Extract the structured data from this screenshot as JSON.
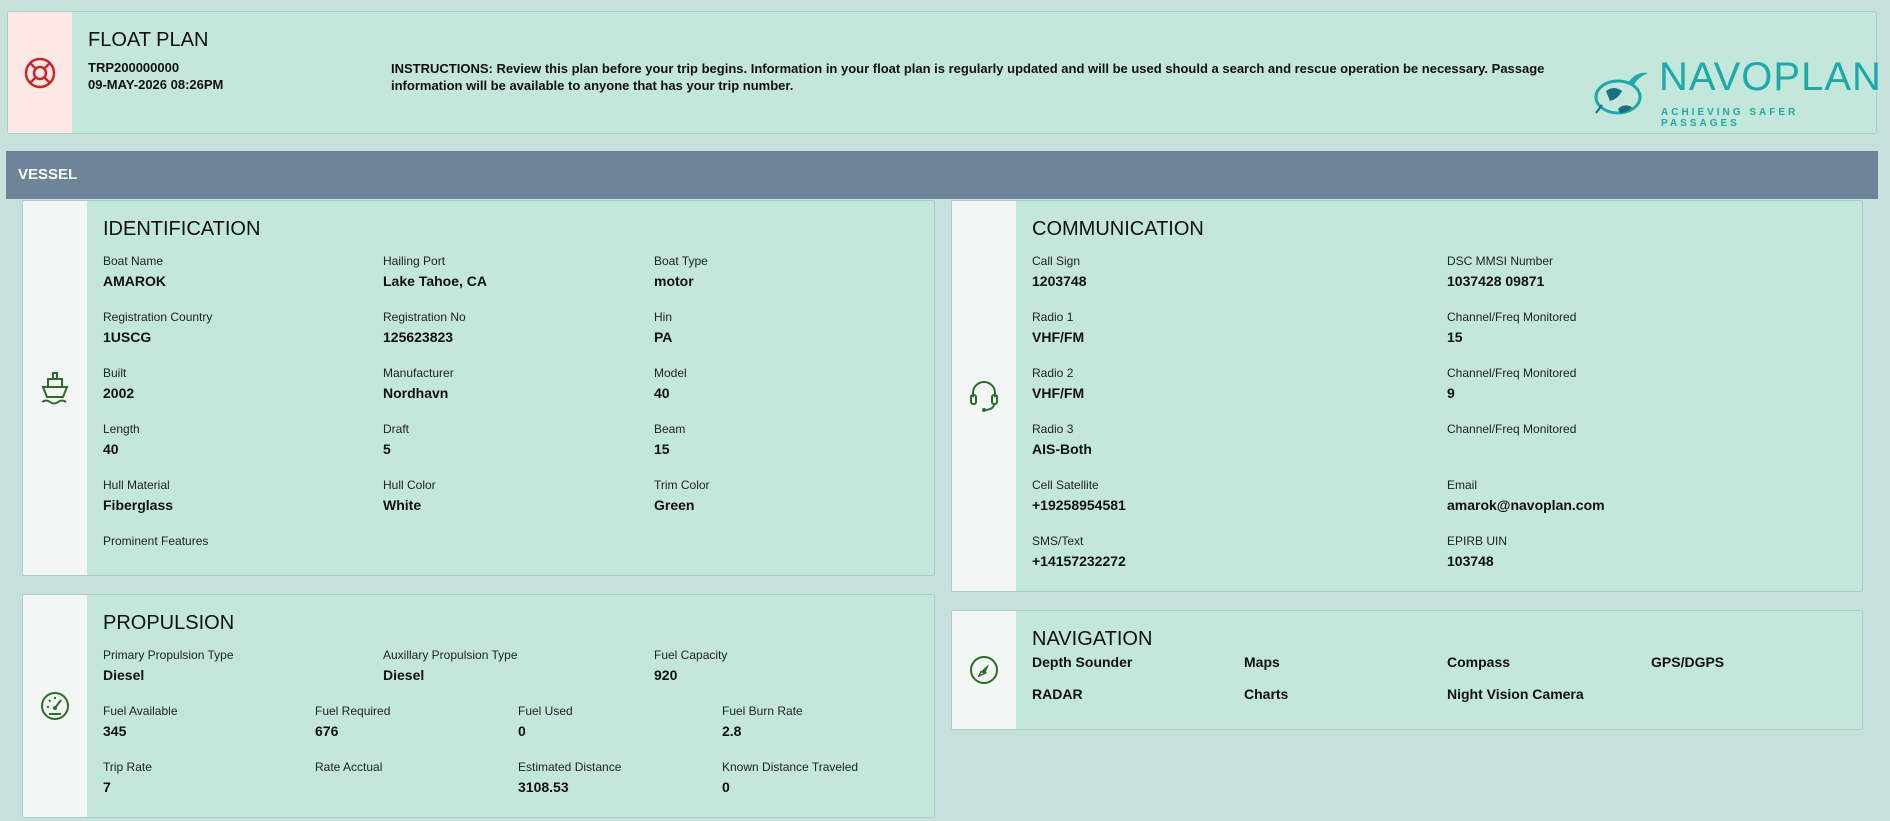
{
  "header": {
    "title": "FLOAT PLAN",
    "trip_number": "TRP200000000",
    "datetime": "09-MAY-2026 08:26PM",
    "instructions": "INSTRUCTIONS: Review this plan before your trip begins. Information in your float plan is regularly updated and will be used should a search and rescue operation be necessary. Passage information will be available to anyone that has your trip number.",
    "logo_text": "NAVOPLAN",
    "logo_tagline": "ACHIEVING SAFER PASSAGES",
    "icon": "lifebuoy-icon"
  },
  "section": {
    "title": "VESSEL"
  },
  "identification": {
    "title": "IDENTIFICATION",
    "icon": "ship-icon",
    "fields": [
      {
        "label": "Boat Name",
        "value": "AMAROK"
      },
      {
        "label": "Hailing Port",
        "value": "Lake Tahoe, CA"
      },
      {
        "label": "Boat Type",
        "value": "motor"
      },
      {
        "label": "Registration Country",
        "value": "1USCG"
      },
      {
        "label": "Registration No",
        "value": "125623823"
      },
      {
        "label": "Hin",
        "value": "PA"
      },
      {
        "label": "Built",
        "value": "2002"
      },
      {
        "label": "Manufacturer",
        "value": "Nordhavn"
      },
      {
        "label": "Model",
        "value": "40"
      },
      {
        "label": "Length",
        "value": "40"
      },
      {
        "label": "Draft",
        "value": "5"
      },
      {
        "label": "Beam",
        "value": "15"
      },
      {
        "label": "Hull Material",
        "value": "Fiberglass"
      },
      {
        "label": "Hull Color",
        "value": "White"
      },
      {
        "label": "Trim Color",
        "value": "Green"
      },
      {
        "label": "Prominent Features",
        "value": ""
      }
    ]
  },
  "communication": {
    "title": "COMMUNICATION",
    "icon": "headset-icon",
    "fields": [
      {
        "label": "Call Sign",
        "value": "1203748"
      },
      {
        "label": "DSC MMSI Number",
        "value": "1037428 09871"
      },
      {
        "label": "Radio 1",
        "value": "VHF/FM"
      },
      {
        "label": "Channel/Freq Monitored",
        "value": "15"
      },
      {
        "label": "Radio 2",
        "value": "VHF/FM"
      },
      {
        "label": "Channel/Freq Monitored",
        "value": "9"
      },
      {
        "label": "Radio 3",
        "value": "AIS-Both"
      },
      {
        "label": "Channel/Freq Monitored",
        "value": ""
      },
      {
        "label": "Cell Satellite",
        "value": "+19258954581"
      },
      {
        "label": "Email",
        "value": "amarok@navoplan.com"
      },
      {
        "label": "SMS/Text",
        "value": "+14157232272"
      },
      {
        "label": "EPIRB UIN",
        "value": "103748"
      }
    ]
  },
  "propulsion": {
    "title": "PROPULSION",
    "icon": "gauge-icon",
    "fields": [
      {
        "label": "Primary Propulsion Type",
        "value": "Diesel"
      },
      {
        "label": "Auxillary Propulsion Type",
        "value": "Diesel"
      },
      {
        "label": "Fuel Capacity",
        "value": "920"
      },
      {
        "label": "Fuel Available",
        "value": "345"
      },
      {
        "label": "Fuel Required",
        "value": "676"
      },
      {
        "label": "Fuel Used",
        "value": "0"
      },
      {
        "label": "Fuel Burn Rate",
        "value": "2.8"
      },
      {
        "label": "Trip Rate",
        "value": "7"
      },
      {
        "label": "Rate Acctual",
        "value": ""
      },
      {
        "label": "Estimated Distance",
        "value": "3108.53"
      },
      {
        "label": "Known Distance Traveled",
        "value": "0"
      }
    ]
  },
  "navigation": {
    "title": "NAVIGATION",
    "icon": "compass-icon",
    "items": [
      "Depth Sounder",
      "Maps",
      "Compass",
      "GPS/DGPS",
      "RADAR",
      "Charts",
      "Night Vision Camera"
    ]
  }
}
